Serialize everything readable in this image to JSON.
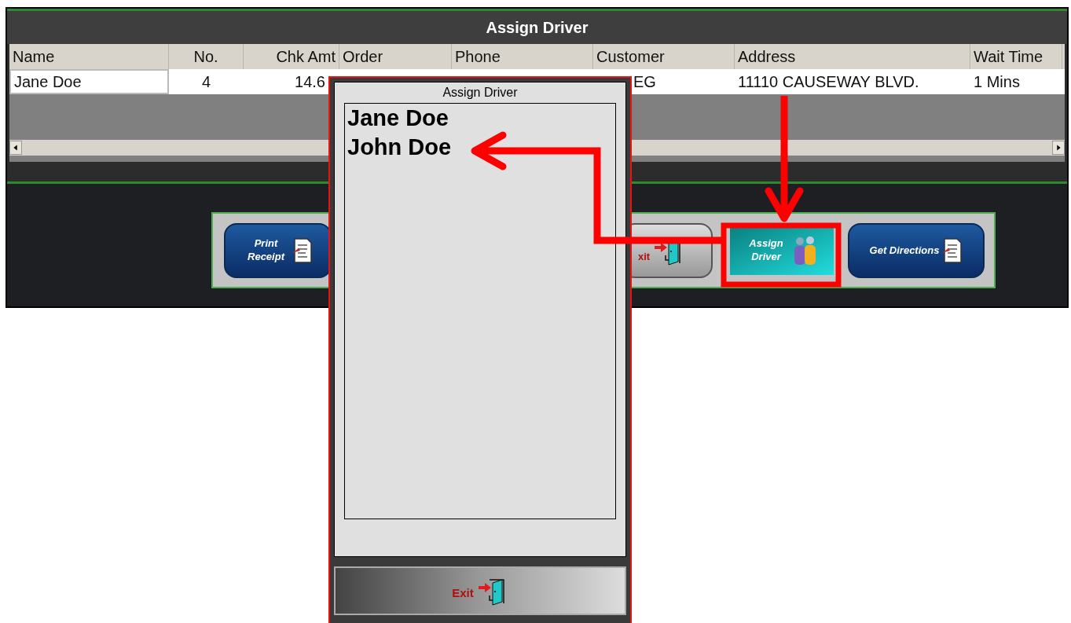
{
  "main_window": {
    "title": "Assign Driver",
    "table": {
      "columns": [
        {
          "label": "Name",
          "cells": [
            "Jane Doe"
          ]
        },
        {
          "label": "No.",
          "cells": [
            "4"
          ]
        },
        {
          "label": "Chk Amt",
          "cells": [
            "14.6"
          ]
        },
        {
          "label": "Order"
        },
        {
          "label": "Phone"
        },
        {
          "label": "Customer",
          "cells": [
            "EG"
          ]
        },
        {
          "label": "Address",
          "cells": [
            "11110 CAUSEWAY BLVD."
          ]
        },
        {
          "label": "Wait Time",
          "cells": [
            "1 Mins"
          ]
        }
      ]
    },
    "buttons": [
      {
        "label": "Print Receipt",
        "kind": "print"
      },
      {
        "label": "xit",
        "kind": "exit"
      },
      {
        "label": "Assign Driver",
        "kind": "assign"
      },
      {
        "label": "Get Directions",
        "kind": "directions"
      }
    ]
  },
  "dialog": {
    "title": "Assign Driver",
    "drivers": [
      "Jane Doe",
      "John Doe"
    ],
    "exit_button": "Exit"
  }
}
